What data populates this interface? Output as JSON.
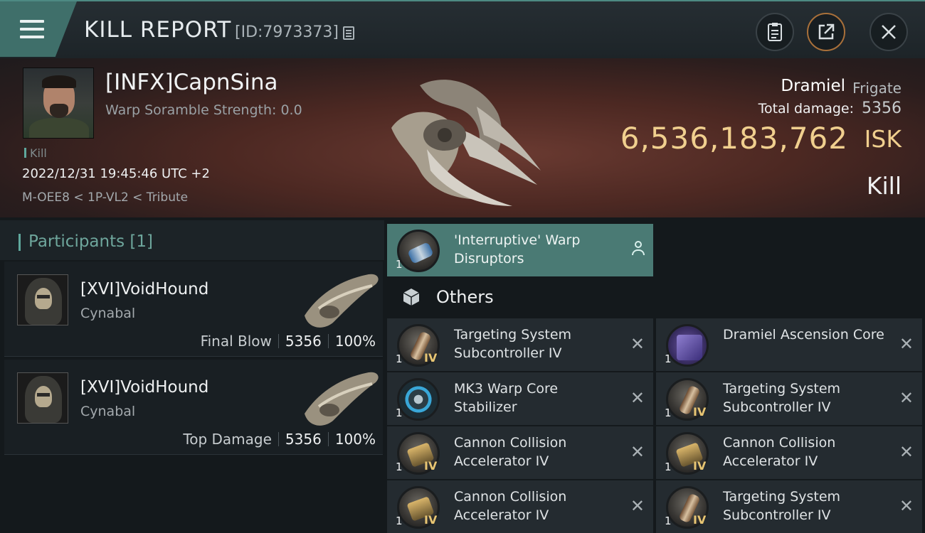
{
  "header": {
    "title": "KILL REPORT",
    "report_id": "[ID:7973373]"
  },
  "victim": {
    "name": "[INFX]CapnSina",
    "warp_scramble": "Warp Soramble Strength: 0.0",
    "kill_tag": "Kill",
    "datetime": "2022/12/31 19:45:46 UTC +2",
    "location": "M-OEE8 < 1P-VL2 < Tribute",
    "ship_name": "Dramiel",
    "ship_class": "Frigate",
    "total_damage_label": "Total damage:",
    "total_damage": "5356",
    "isk_value": "6,536,183,762",
    "isk_unit": "ISK",
    "result": "Kill"
  },
  "participants": {
    "title": "Participants",
    "count": "[1]",
    "items": [
      {
        "name": "[XVI]VoidHound",
        "ship": "Cynabal",
        "role": "Final Blow",
        "damage": "5356",
        "percent": "100%"
      },
      {
        "name": "[XVI]VoidHound",
        "ship": "Cynabal",
        "role": "Top Damage",
        "damage": "5356",
        "percent": "100%"
      }
    ]
  },
  "fitted": [
    {
      "qty": "1",
      "name": "'Interruptive' Warp Disruptors",
      "icon": "warp-disruptor-icon"
    }
  ],
  "others": {
    "label": "Others",
    "items": [
      {
        "qty": "1",
        "tier": "IV",
        "name": "Targeting System Subcontroller IV",
        "icon": "targeting-system-icon"
      },
      {
        "qty": "1",
        "tier": "",
        "name": "Dramiel Ascension Core",
        "icon": "ascension-core-icon"
      },
      {
        "qty": "1",
        "tier": "",
        "name": "MK3 Warp Core Stabilizer",
        "icon": "warp-core-stabilizer-icon"
      },
      {
        "qty": "1",
        "tier": "IV",
        "name": "Targeting System Subcontroller IV",
        "icon": "targeting-system-icon"
      },
      {
        "qty": "1",
        "tier": "IV",
        "name": "Cannon Collision Accelerator IV",
        "icon": "cannon-accelerator-icon"
      },
      {
        "qty": "1",
        "tier": "IV",
        "name": "Cannon Collision Accelerator IV",
        "icon": "cannon-accelerator-icon"
      },
      {
        "qty": "1",
        "tier": "IV",
        "name": "Cannon Collision Accelerator IV",
        "icon": "cannon-accelerator-icon"
      },
      {
        "qty": "1",
        "tier": "IV",
        "name": "Targeting System Subcontroller IV",
        "icon": "targeting-system-icon"
      }
    ]
  },
  "colors": {
    "accent": "#5fa89d",
    "isk_gold": "#f0cf8e",
    "highlight_cell": "#4a7a74"
  }
}
